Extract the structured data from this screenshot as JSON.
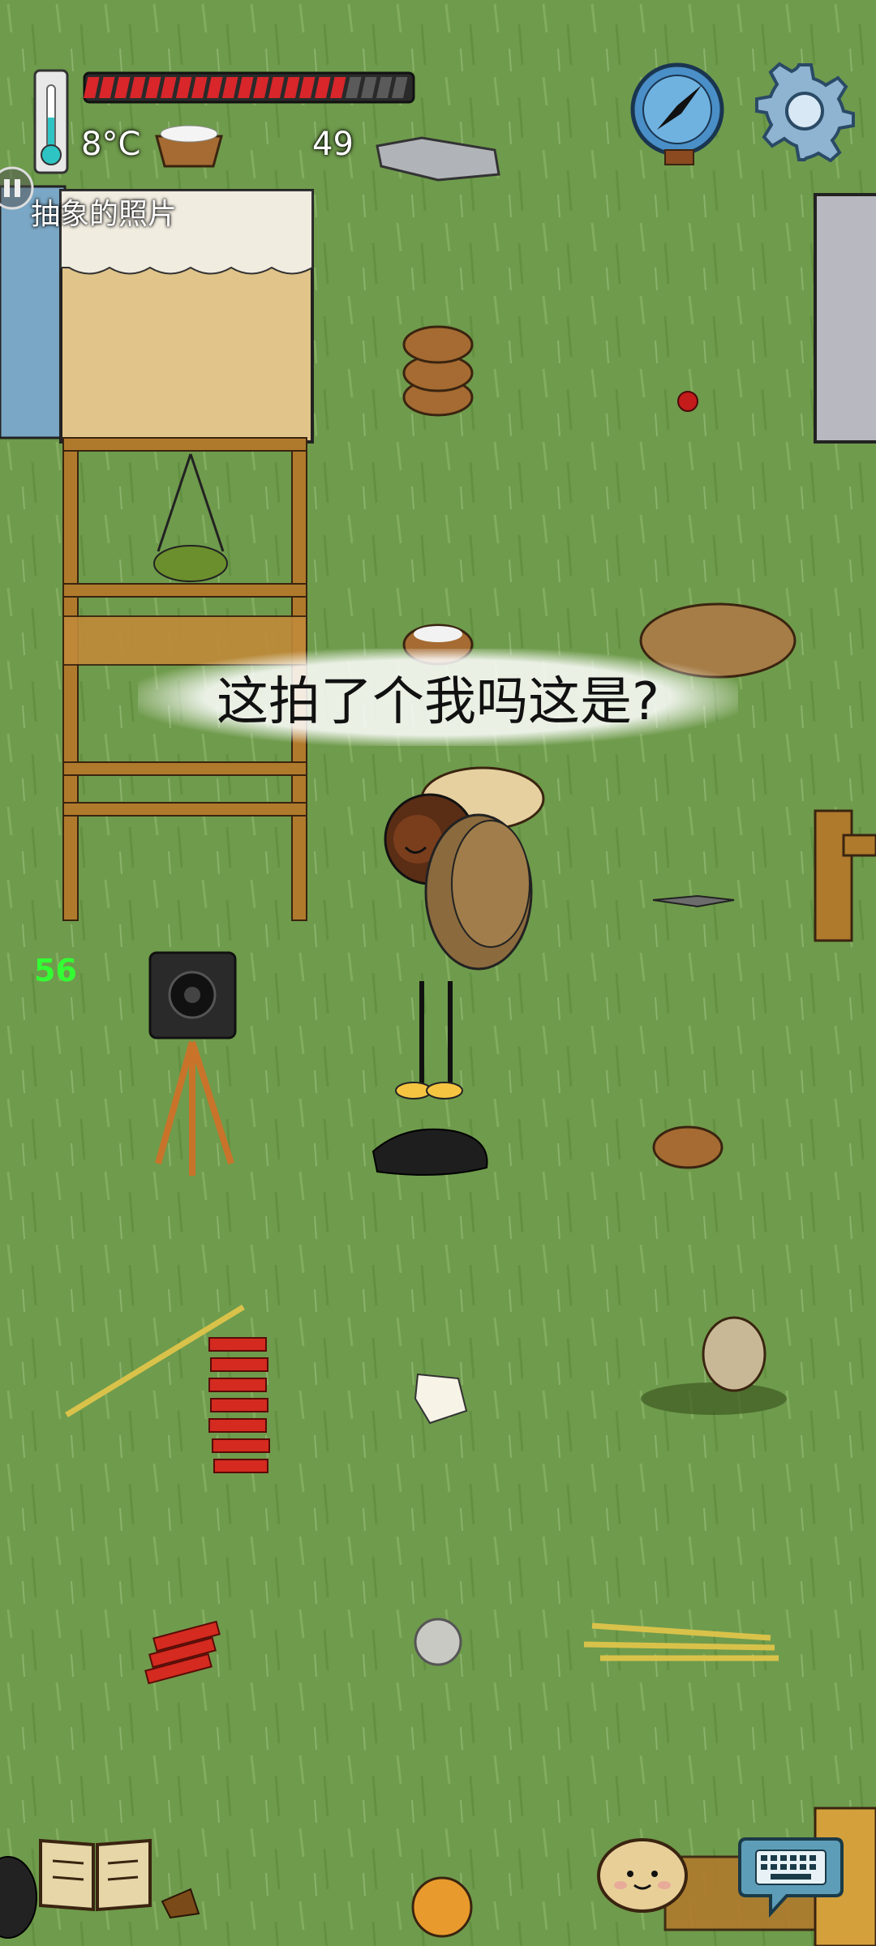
{
  "hud": {
    "temperature": "8°C",
    "count": "49",
    "health_fraction": 0.81,
    "item_label": "抽象的照片"
  },
  "speech": {
    "text": "这拍了个我吗这是?"
  },
  "overlay": {
    "counter": "56"
  },
  "icons": {
    "thermometer": "thermometer-icon",
    "compass": "compass-icon",
    "settings": "gear-icon",
    "recipe_book": "book-icon",
    "emote": "face-icon",
    "keyboard": "keyboard-icon"
  },
  "colors": {
    "grass": "#6f9b4c",
    "health_red": "#d8262b",
    "counter_green": "#33ff33"
  }
}
